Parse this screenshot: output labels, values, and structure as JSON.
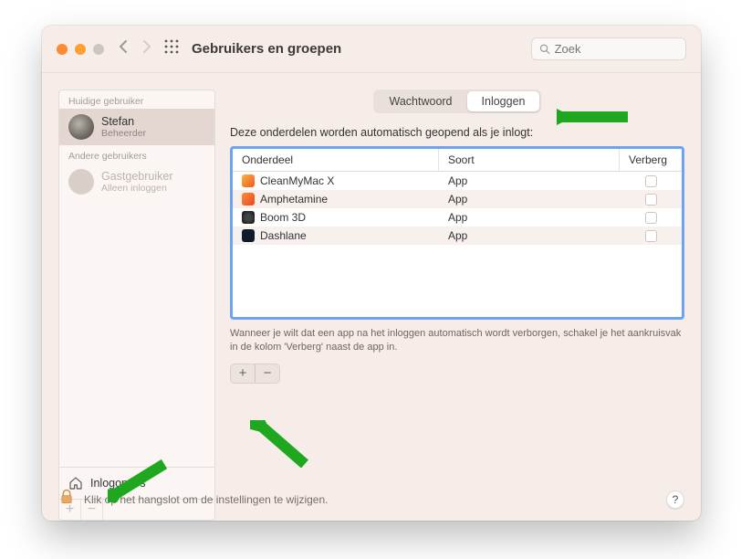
{
  "window": {
    "title": "Gebruikers en groepen"
  },
  "search": {
    "placeholder": "Zoek"
  },
  "sidebar": {
    "current_label": "Huidige gebruiker",
    "other_label": "Andere gebruikers",
    "current_user": {
      "name": "Stefan",
      "role": "Beheerder"
    },
    "guest_user": {
      "name": "Gastgebruiker",
      "role": "Alleen inloggen"
    },
    "login_options": "Inlogopties"
  },
  "tabs": {
    "password": "Wachtwoord",
    "login": "Inloggen"
  },
  "main": {
    "description": "Deze onderdelen worden automatisch geopend als je inlogt:",
    "hint": "Wanneer je wilt dat een app na het inloggen automatisch wordt verborgen, schakel je het aankruisvak in de kolom 'Verberg' naast de app in."
  },
  "table": {
    "headers": {
      "item": "Onderdeel",
      "kind": "Soort",
      "hide": "Verberg"
    },
    "rows": [
      {
        "name": "CleanMyMac X",
        "kind": "App",
        "icon_bg": "linear-gradient(135deg,#fcb03b,#f15a24)"
      },
      {
        "name": "Amphetamine",
        "kind": "App",
        "icon_bg": "linear-gradient(135deg,#ff8c3b,#e84a1c)"
      },
      {
        "name": "Boom 3D",
        "kind": "App",
        "icon_bg": "radial-gradient(circle,#444 30%,#111 100%)"
      },
      {
        "name": "Dashlane",
        "kind": "App",
        "icon_bg": "#0e1b2c"
      }
    ]
  },
  "lockbar": {
    "text": "Klik op het hangslot om de instellingen te wijzigen."
  }
}
